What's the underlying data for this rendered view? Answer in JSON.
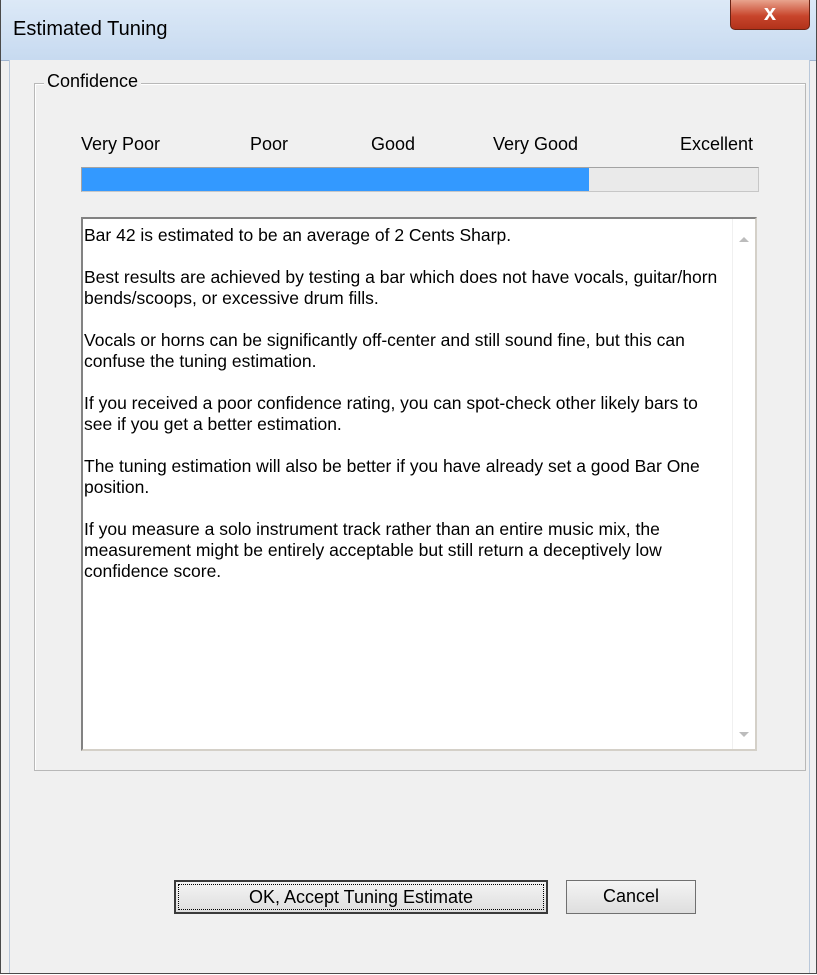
{
  "window": {
    "title": "Estimated Tuning",
    "close_label": "x"
  },
  "confidence": {
    "group_label": "Confidence",
    "scale": [
      "Very Poor",
      "Poor",
      "Good",
      "Very Good",
      "Excellent"
    ],
    "level": 0.75
  },
  "message": {
    "paragraphs": [
      "Bar 42 is estimated to be an average of 2 Cents Sharp.",
      "Best results are achieved by testing a bar which does not have vocals, guitar/horn bends/scoops, or excessive drum fills.",
      "Vocals or horns can be significantly off-center and still sound fine, but this can confuse the tuning estimation.",
      "If you received a poor confidence rating, you can spot-check other likely bars to see if you get a better estimation.",
      "The tuning estimation will also be better if you have already set a good Bar One position.",
      "If you measure a solo instrument track rather than an entire music mix, the measurement might be entirely acceptable but still return a deceptively low confidence score."
    ]
  },
  "buttons": {
    "ok_label": "OK, Accept Tuning Estimate",
    "cancel_label": "Cancel"
  },
  "colors": {
    "progress_fill": "#3399ff"
  }
}
